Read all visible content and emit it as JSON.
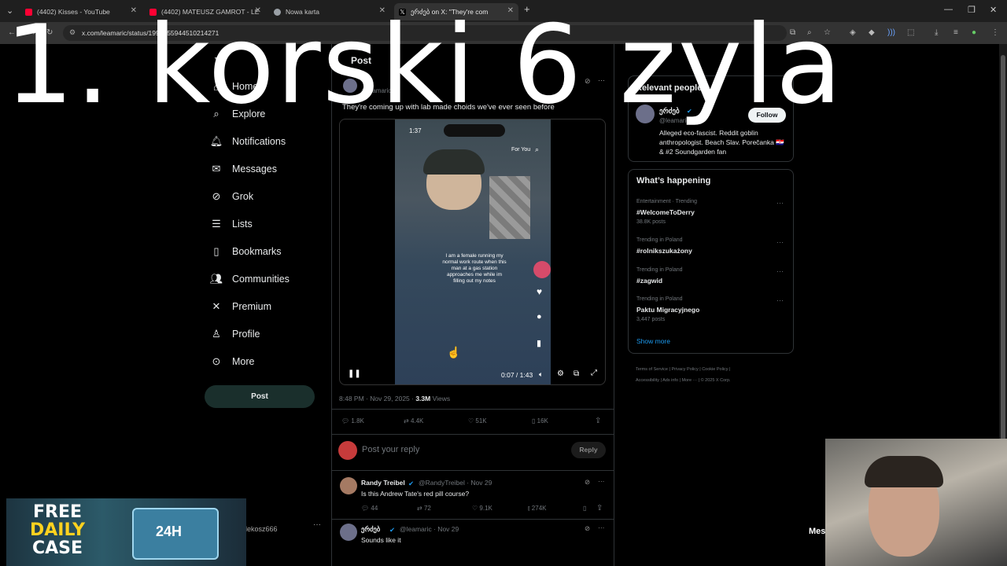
{
  "browser": {
    "tabs": [
      {
        "title": "(4402) Kisses - YouTube",
        "favicon_color": "#ff0033"
      },
      {
        "title": "(4402) MATEUSZ GAMROT - LE",
        "favicon_color": "#ff0033"
      },
      {
        "title": "Nowa karta",
        "favicon_color": "#9aa0a6"
      },
      {
        "title": "ერძებ on X: \"They're com",
        "favicon_color": "#ffffff"
      }
    ],
    "url": "x.com/leamaric/status/1994855944510214271"
  },
  "overlay_text": "1. korski 6 zyla",
  "sidebar": {
    "items": [
      {
        "label": "Home",
        "icon": "home-icon"
      },
      {
        "label": "Explore",
        "icon": "search-icon"
      },
      {
        "label": "Notifications",
        "icon": "bell-icon"
      },
      {
        "label": "Messages",
        "icon": "mail-icon"
      },
      {
        "label": "Grok",
        "icon": "grok-icon"
      },
      {
        "label": "Lists",
        "icon": "list-icon"
      },
      {
        "label": "Bookmarks",
        "icon": "bookmark-icon"
      },
      {
        "label": "Communities",
        "icon": "people-icon"
      },
      {
        "label": "Premium",
        "icon": "x-icon"
      },
      {
        "label": "Profile",
        "icon": "person-icon"
      },
      {
        "label": "More",
        "icon": "more-circle-icon"
      }
    ],
    "post_button": "Post",
    "account_handle": "lekosz666"
  },
  "post": {
    "header": "Post",
    "author_handle": "@leamaric",
    "text": "They're coming up with lab made choids we've ever seen before",
    "video": {
      "phone_time": "1:37",
      "phone_tab": "For You",
      "caption": "I am a female running my normal work route when this man at a gas station approaches me while im filling out my notes",
      "time": "0:07 / 1:43"
    },
    "timestamp": "8:48 PM · Nov 29, 2025 · ",
    "views": "3.3M",
    "views_label": " Views",
    "stats": {
      "replies": "1.8K",
      "reposts": "4.4K",
      "likes": "51K",
      "bookmarks": "16K"
    },
    "reply_placeholder": "Post your reply",
    "reply_button": "Reply"
  },
  "replies": [
    {
      "name": "Randy Treibel",
      "handle": "@RandyTreibel · Nov 29",
      "text": "Is this Andrew Tate's red pill course?",
      "replies": "44",
      "reposts": "72",
      "likes": "9.1K",
      "views": "274K"
    },
    {
      "name": "ერძებ",
      "handle": "@leamaric · Nov 29",
      "text": "Sounds like it"
    }
  ],
  "relevant": {
    "title": "Relevant people",
    "name": "ერძებ",
    "handle": "@leamaric",
    "bio": "Alleged eco-fascist. Reddit goblin anthropologist. Beach Slav. Porečanka 🇭🇷 & #2 Soundgarden fan",
    "follow": "Follow"
  },
  "happening": {
    "title": "What’s happening",
    "trends": [
      {
        "cat": "Entertainment · Trending",
        "name": "#WelcomeToDerry",
        "posts": "38.8K posts"
      },
      {
        "cat": "Trending in Poland",
        "name": "#rolnikszukażony",
        "posts": ""
      },
      {
        "cat": "Trending in Poland",
        "name": "#zagwid",
        "posts": ""
      },
      {
        "cat": "Trending in Poland",
        "name": "Paktu Migracyjnego",
        "posts": "3,447 posts"
      }
    ],
    "show_more": "Show more"
  },
  "footer": [
    "Terms of Service",
    "Privacy Policy",
    "Cookie Policy",
    "Accessibility",
    "Ads info",
    "More ···",
    "© 2025 X Corp."
  ],
  "ad": {
    "line1": "FREE",
    "line2": "DAILY",
    "line3": "CASE",
    "badge": "24H"
  },
  "messages_label": "Mes",
  "colors": {
    "accent": "#1d9bf0",
    "bg": "#000000",
    "muted": "#71767b"
  }
}
